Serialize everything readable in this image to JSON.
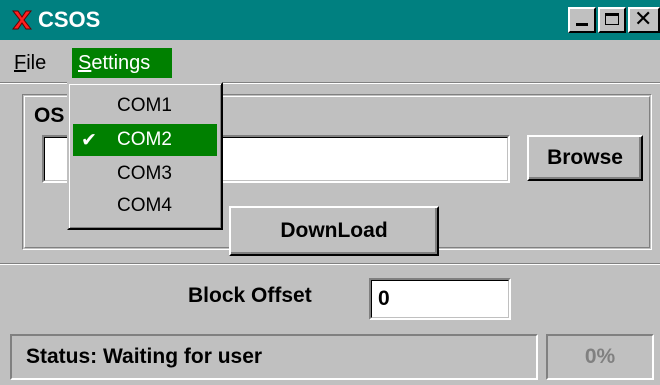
{
  "window": {
    "title": "CSOS",
    "icon": "csos-app-icon",
    "controls": {
      "minimize": "minimize-icon",
      "maximize": "maximize-icon",
      "close": "close-icon"
    }
  },
  "menubar": {
    "items": [
      {
        "label": "File",
        "accelerator": "F",
        "rest": "ile"
      },
      {
        "label": "Settings",
        "accelerator": "S",
        "rest": "ettings",
        "active": true
      }
    ]
  },
  "settings_menu": {
    "items": [
      {
        "label": "COM1",
        "checked": false
      },
      {
        "label": "COM2",
        "checked": true
      },
      {
        "label": "COM3",
        "checked": false
      },
      {
        "label": "COM4",
        "checked": false
      }
    ],
    "check_glyph": "✔"
  },
  "os_group": {
    "label_visible": "OS",
    "path_value": "",
    "browse_label": "Browse"
  },
  "download": {
    "label": "DownLoad"
  },
  "block_offset": {
    "label": "Block Offset",
    "value": "0"
  },
  "status": {
    "text": "Status:  Waiting for user",
    "progress": "0%"
  },
  "colors": {
    "titlebar": "#008080",
    "selection": "#008000",
    "face": "#c0c0c0"
  }
}
